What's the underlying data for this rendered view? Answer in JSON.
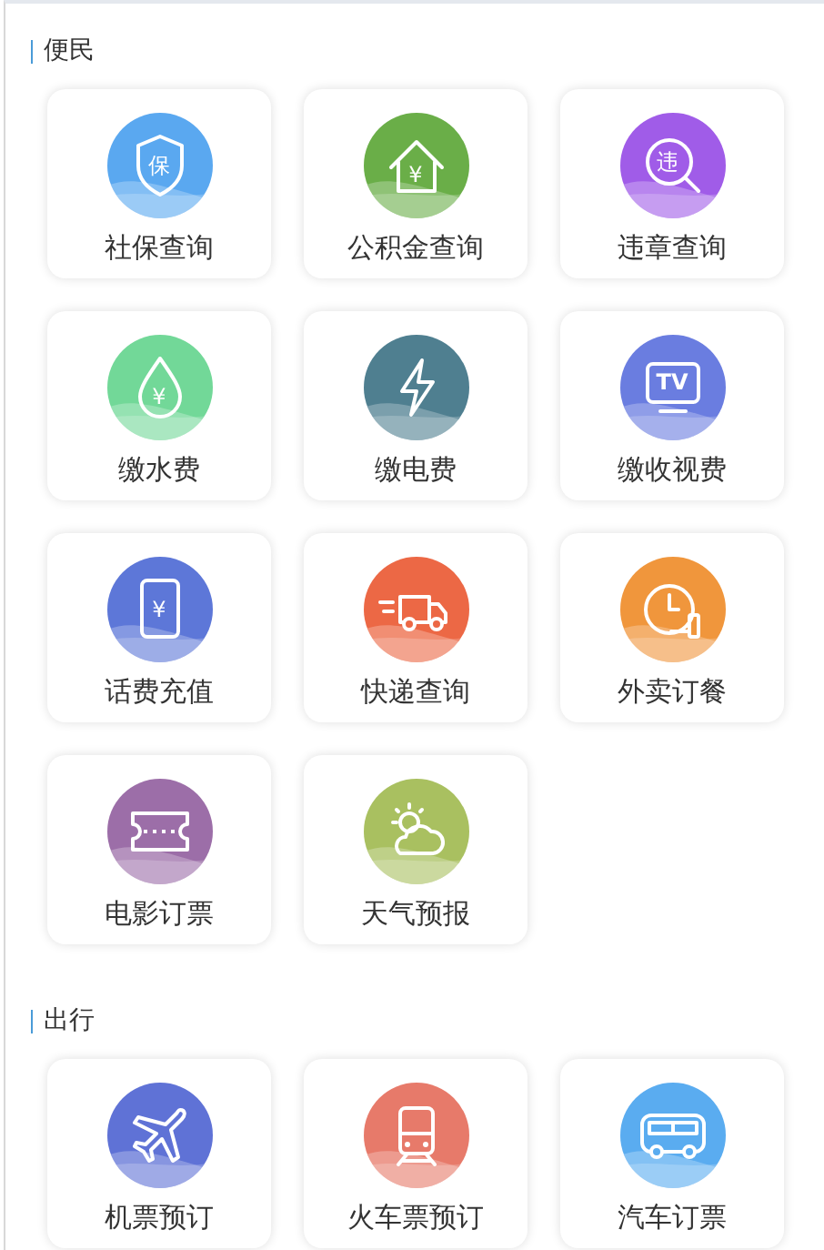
{
  "sections": [
    {
      "title": "便民",
      "items": [
        {
          "label": "社保查询",
          "kind": "shield",
          "glyph": "保",
          "color": "#5aa8f0"
        },
        {
          "label": "公积金查询",
          "kind": "house",
          "glyph": "¥",
          "color": "#6aae48"
        },
        {
          "label": "违章查询",
          "kind": "magnifier",
          "glyph": "违",
          "color": "#a05ce8"
        },
        {
          "label": "缴水费",
          "kind": "drop",
          "glyph": "¥",
          "color": "#72d898"
        },
        {
          "label": "缴电费",
          "kind": "bolt",
          "color": "#4f7f90"
        },
        {
          "label": "缴收视费",
          "kind": "tv",
          "glyph": "TV",
          "color": "#6a7de0"
        },
        {
          "label": "话费充值",
          "kind": "phone",
          "glyph": "¥",
          "color": "#5d77d8"
        },
        {
          "label": "快递查询",
          "kind": "truck",
          "color": "#ec6845"
        },
        {
          "label": "外卖订餐",
          "kind": "clock",
          "color": "#f0963c"
        },
        {
          "label": "电影订票",
          "kind": "ticket",
          "color": "#9c6ea8"
        },
        {
          "label": "天气预报",
          "kind": "cloud",
          "color": "#a9c060"
        }
      ]
    },
    {
      "title": "出行",
      "items": [
        {
          "label": "机票预订",
          "kind": "plane",
          "color": "#5f72d6"
        },
        {
          "label": "火车票预订",
          "kind": "train",
          "color": "#e77a6a"
        },
        {
          "label": "汽车订票",
          "kind": "bus",
          "color": "#5aacf0"
        }
      ]
    }
  ]
}
